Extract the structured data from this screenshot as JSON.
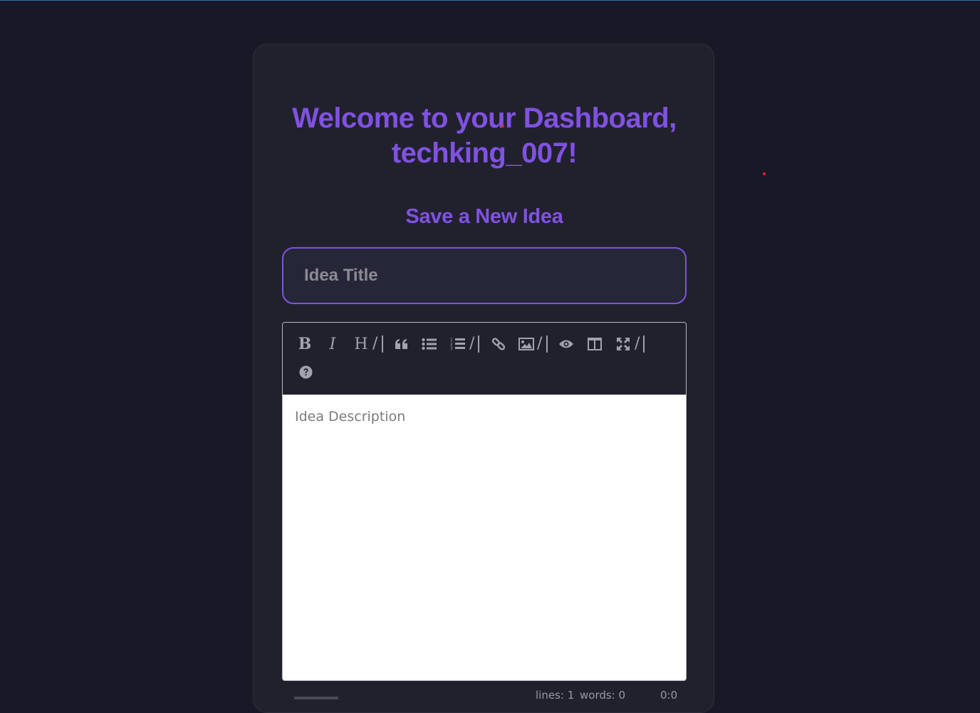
{
  "dashboard": {
    "welcome_line1": "Welcome to your Dashboard,",
    "welcome_line2": "techking_007!",
    "subtitle": "Save a New Idea"
  },
  "form": {
    "title_placeholder": "Idea Title",
    "description_placeholder": "Idea Description"
  },
  "editor": {
    "toolbar": [
      {
        "name": "bold",
        "icon": "bold-icon",
        "label": "B"
      },
      {
        "name": "italic",
        "icon": "italic-icon",
        "label": "I"
      },
      {
        "name": "heading",
        "icon": "heading-icon",
        "label": "H"
      },
      {
        "name": "quote",
        "icon": "quote-icon"
      },
      {
        "name": "unordered-list",
        "icon": "unordered-list-icon"
      },
      {
        "name": "ordered-list",
        "icon": "ordered-list-icon"
      },
      {
        "name": "link",
        "icon": "link-icon"
      },
      {
        "name": "image",
        "icon": "image-icon"
      },
      {
        "name": "preview",
        "icon": "eye-icon"
      },
      {
        "name": "side-by-side",
        "icon": "columns-icon"
      },
      {
        "name": "fullscreen",
        "icon": "fullscreen-icon"
      },
      {
        "name": "guide",
        "icon": "question-icon"
      }
    ],
    "status": {
      "lines": "lines: 1",
      "words": "words: 0",
      "cursor": "0:0"
    }
  },
  "colors": {
    "background": "#181826",
    "card": "#21212e",
    "accent": "#8052e0",
    "input_bg": "#262639"
  }
}
